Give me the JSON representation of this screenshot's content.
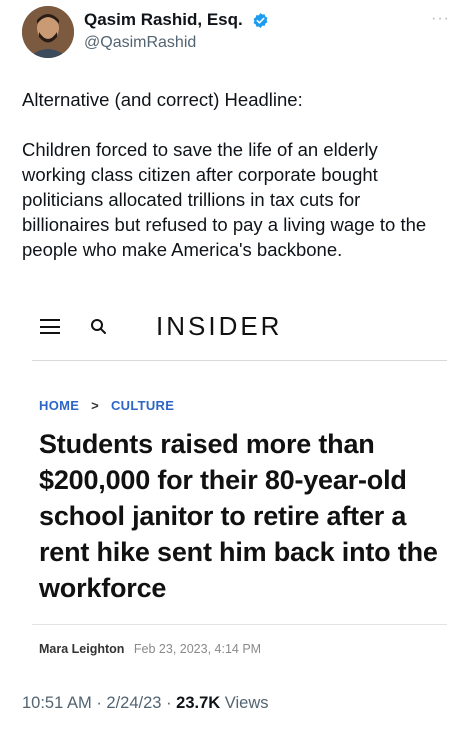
{
  "tweet": {
    "author_name": "Qasim Rashid, Esq.",
    "handle": "@QasimRashid",
    "verified_color": "#1d9bf0",
    "paragraph1": "Alternative (and correct) Headline:",
    "paragraph2": "Children forced to save the life of an elderly working class citizen after corporate bought politicians allocated trillions in tax cuts for billionaires but refused to pay a living wage to the people who make America's backbone."
  },
  "article": {
    "brand": "INSIDER",
    "breadcrumb": {
      "home": "HOME",
      "separator": ">",
      "section": "CULTURE"
    },
    "breadcrumb_color": "#2e66c7",
    "headline": "Students raised more than $200,000 for their 80-year-old school janitor to retire after a rent hike sent him back into the workforce",
    "byline_author": "Mara Leighton",
    "byline_date": "Feb 23, 2023, 4:14 PM"
  },
  "meta": {
    "time": "10:51 AM",
    "dot1": "·",
    "date": "2/24/23",
    "dot2": "·",
    "views_count": "23.7K",
    "views_label": "Views"
  }
}
